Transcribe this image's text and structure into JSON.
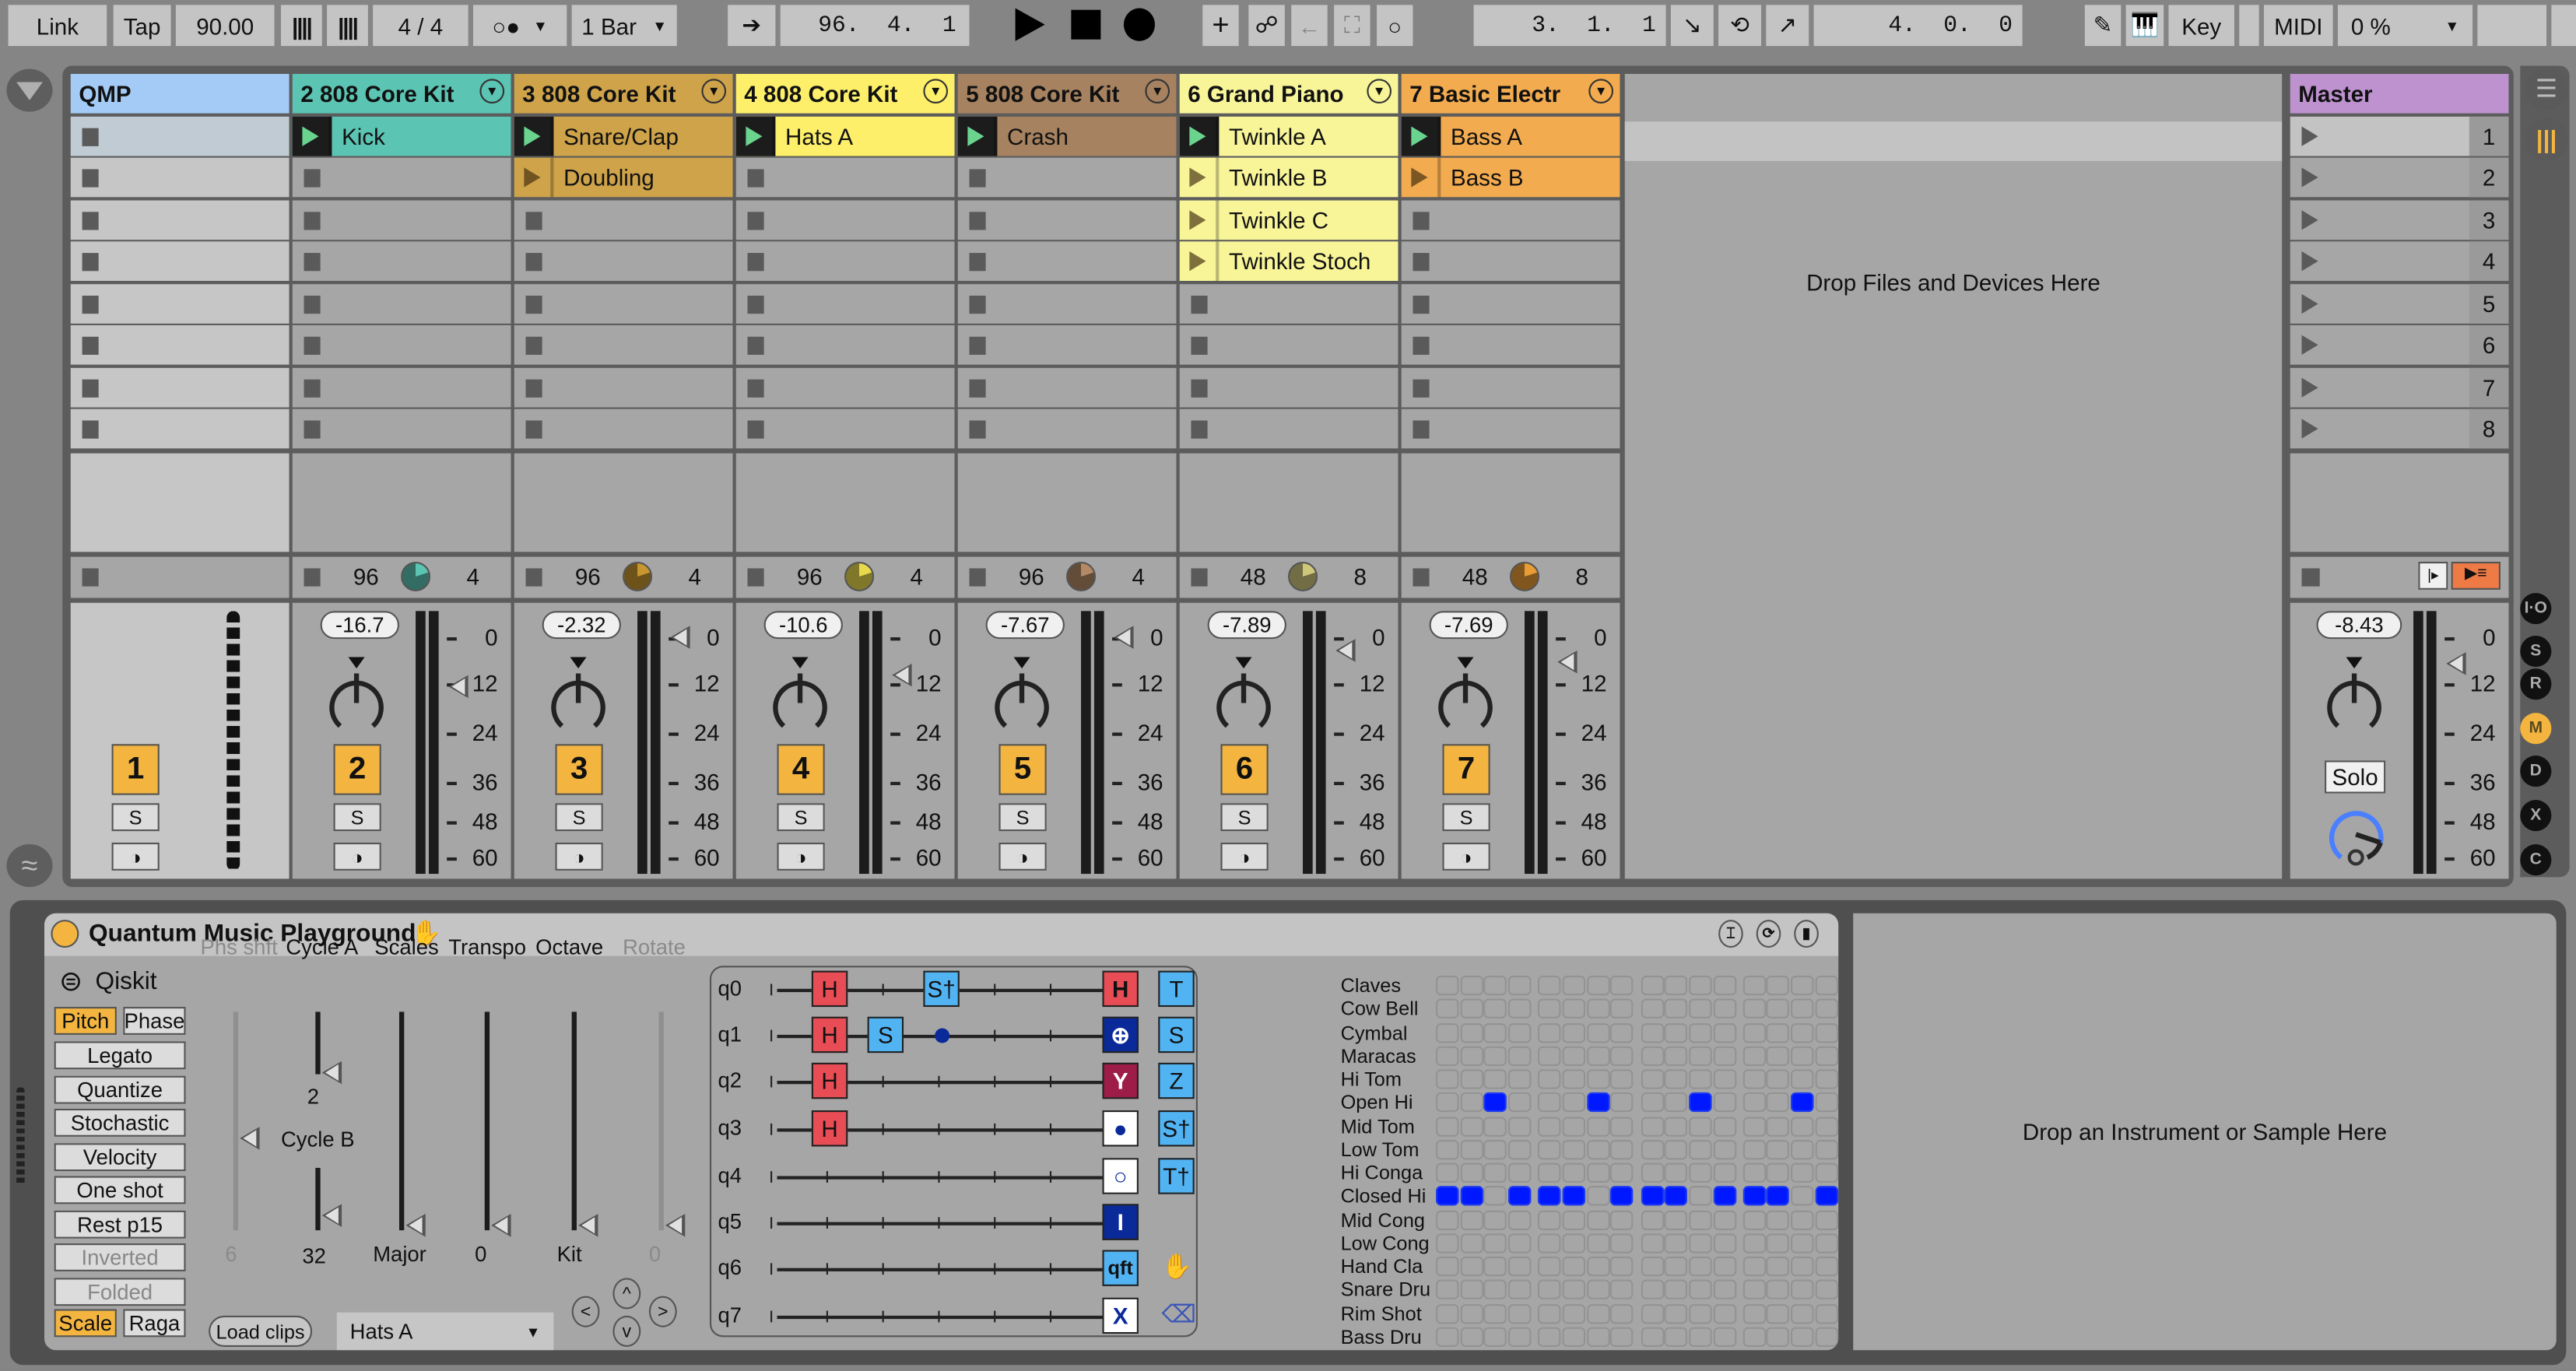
{
  "transport": {
    "link": "Link",
    "tap": "Tap",
    "tempo": "90.00",
    "time_signature": "4 / 4",
    "overdub_icon": "metronome-icon",
    "quantization": "1 Bar",
    "arrangement_position": "96.  4.  1",
    "loop_start": "3.  1.  1",
    "loop_length": "4.  0.  0",
    "key": "Key",
    "midi": "MIDI",
    "cpu": "0 %"
  },
  "session": {
    "drop_files_text": "Drop Files and Devices Here",
    "tracks": [
      {
        "name": "QMP",
        "color": "#a3cbf5",
        "clips": [],
        "number": "1",
        "type": "midi"
      },
      {
        "name": "2 808 Core Kit",
        "color": "#5bc4b3",
        "clips": [
          {
            "row": 0,
            "name": "Kick",
            "playing": true
          }
        ],
        "number": "2",
        "volume": "-16.7",
        "status": {
          "left": "96",
          "right": "4",
          "knob_color": "#5bc4b3"
        },
        "fader_db": 10
      },
      {
        "name": "3 808 Core Kit",
        "color": "#cea34a",
        "clips": [
          {
            "row": 0,
            "name": "Snare/Clap",
            "playing": true
          },
          {
            "row": 1,
            "name": "Doubling",
            "playing": false
          }
        ],
        "number": "3",
        "volume": "-2.32",
        "status": {
          "left": "96",
          "right": "4",
          "knob_color": "#c7962e"
        },
        "fader_db": -2
      },
      {
        "name": "4 808 Core Kit",
        "color": "#fdef6a",
        "clips": [
          {
            "row": 0,
            "name": "Hats A",
            "playing": true
          }
        ],
        "number": "4",
        "volume": "-10.6",
        "status": {
          "left": "96",
          "right": "4",
          "knob_color": "#e8d84c"
        },
        "fader_db": 7
      },
      {
        "name": "5 808 Core Kit",
        "color": "#a68260",
        "clips": [
          {
            "row": 0,
            "name": "Crash",
            "playing": true
          }
        ],
        "number": "5",
        "volume": "-7.67",
        "status": {
          "left": "96",
          "right": "4",
          "knob_color": "#b48a66"
        },
        "fader_db": -2
      },
      {
        "name": "6 Grand Piano",
        "color": "#f8f599",
        "clips": [
          {
            "row": 0,
            "name": "Twinkle A",
            "playing": true
          },
          {
            "row": 1,
            "name": "Twinkle B",
            "playing": false
          },
          {
            "row": 2,
            "name": "Twinkle C",
            "playing": false
          },
          {
            "row": 3,
            "name": "Twinkle Stoch",
            "playing": false
          }
        ],
        "number": "6",
        "volume": "-7.89",
        "status": {
          "left": "48",
          "right": "8",
          "knob_color": "#cfc77b"
        },
        "fader_db": 1
      },
      {
        "name": "7 Basic Electr",
        "color": "#f2ab4f",
        "clips": [
          {
            "row": 0,
            "name": "Bass A",
            "playing": true
          },
          {
            "row": 1,
            "name": "Bass B",
            "playing": false
          }
        ],
        "number": "7",
        "volume": "-7.69",
        "status": {
          "left": "48",
          "right": "8",
          "knob_color": "#e99c36"
        },
        "fader_db": 4
      }
    ],
    "master": {
      "name": "Master",
      "color": "#bd92cf",
      "scenes": [
        "1",
        "2",
        "3",
        "4",
        "5",
        "6",
        "7",
        "8"
      ],
      "volume": "-8.43",
      "solo_label": "Solo"
    },
    "meter_scale": [
      "0",
      "12",
      "24",
      "36",
      "48",
      "60"
    ],
    "solo_label": "S",
    "right_toggles": [
      "I·O",
      "S",
      "R",
      "M",
      "D",
      "X",
      "C"
    ]
  },
  "device": {
    "title": "Quantum Music Playground",
    "logo_text": "Qiskit",
    "left_buttons": [
      {
        "label": "Pitch",
        "on": true
      },
      {
        "label": "Phase",
        "on": false
      },
      {
        "label": "Legato"
      },
      {
        "label": "Quantize"
      },
      {
        "label": "Stochastic"
      },
      {
        "label": "Velocity"
      },
      {
        "label": "One shot"
      },
      {
        "label": "Rest p15"
      },
      {
        "label": "Inverted",
        "dim": true
      },
      {
        "label": "Folded",
        "dim": true
      },
      {
        "label": "Scale",
        "on": true
      },
      {
        "label": "Raga",
        "on": false
      }
    ],
    "params": [
      {
        "label": "Phs shft",
        "value": "6",
        "dim": true
      },
      {
        "label": "Cycle A",
        "value": "2"
      },
      {
        "label": "Cycle B",
        "value": "32"
      },
      {
        "label": "Scales",
        "value": "Major"
      },
      {
        "label": "Transpo",
        "value": "0"
      },
      {
        "label": "Octave",
        "value": "Kit"
      },
      {
        "label": "Rotate",
        "value": "0",
        "dim": true
      }
    ],
    "load_clips": "Load clips",
    "clip_select": "Hats A",
    "nav": [
      "<",
      "^",
      ">",
      "v"
    ],
    "qubits": [
      "q0",
      "q1",
      "q2",
      "q3",
      "q4",
      "q5",
      "q6",
      "q7"
    ],
    "circuit": [
      {
        "qubit": 0,
        "step": 1,
        "gate": "H"
      },
      {
        "qubit": 0,
        "step": 3,
        "gate": "S†"
      },
      {
        "qubit": 1,
        "step": 1,
        "gate": "H"
      },
      {
        "qubit": 1,
        "step": 2,
        "gate": "S"
      },
      {
        "qubit": 1,
        "step": 3,
        "gate": "ctrl"
      },
      {
        "qubit": 2,
        "step": 1,
        "gate": "H"
      },
      {
        "qubit": 3,
        "step": 1,
        "gate": "H"
      }
    ],
    "palette_left": [
      "H",
      "⊕",
      "Y",
      "●",
      "○",
      "I",
      "qft",
      "X"
    ],
    "palette_right": [
      "T",
      "S",
      "Z",
      "S†",
      "T†",
      "",
      "hand",
      "backspace"
    ],
    "drum_rows": [
      {
        "name": "Claves",
        "steps": []
      },
      {
        "name": "Cow Bell",
        "steps": []
      },
      {
        "name": "Cymbal",
        "steps": []
      },
      {
        "name": "Maracas",
        "steps": []
      },
      {
        "name": "Hi Tom",
        "steps": []
      },
      {
        "name": "Open Hi",
        "steps": [
          3,
          7,
          11,
          15
        ]
      },
      {
        "name": "Mid Tom",
        "steps": []
      },
      {
        "name": "Low Tom",
        "steps": []
      },
      {
        "name": "Hi Conga",
        "steps": []
      },
      {
        "name": "Closed Hi",
        "steps": [
          1,
          2,
          4,
          5,
          6,
          8,
          9,
          10,
          12,
          13,
          14,
          16
        ]
      },
      {
        "name": "Mid Cong",
        "steps": []
      },
      {
        "name": "Low Cong",
        "steps": []
      },
      {
        "name": "Hand Cla",
        "steps": []
      },
      {
        "name": "Snare Dru",
        "steps": []
      },
      {
        "name": "Rim Shot",
        "steps": []
      },
      {
        "name": "Bass Dru",
        "steps": []
      }
    ],
    "drop_instrument_text": "Drop an Instrument or Sample Here"
  }
}
